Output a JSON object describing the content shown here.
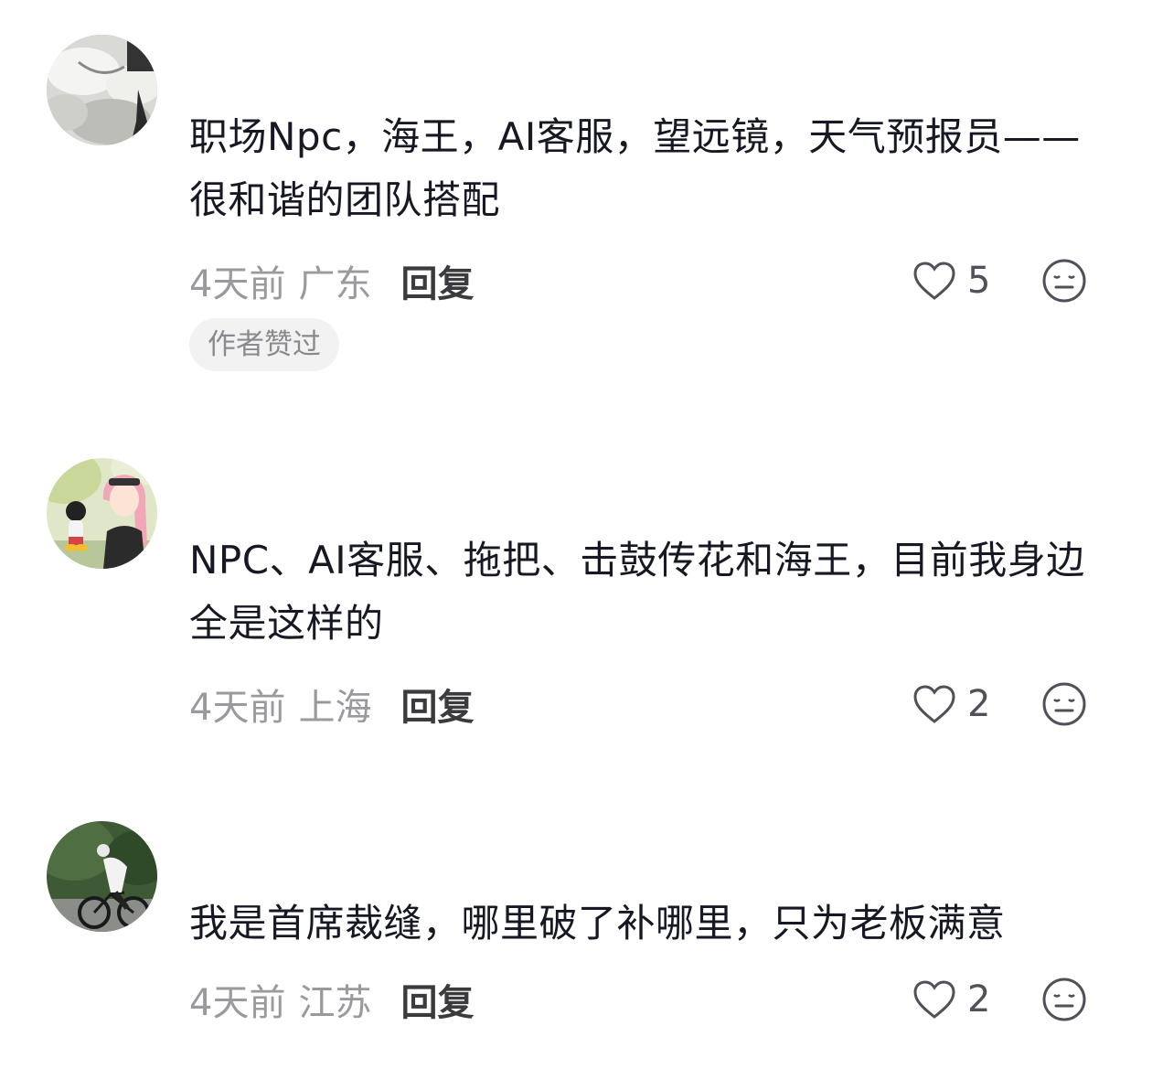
{
  "comments": [
    {
      "text": "职场Npc，海王，AI客服，望远镜，天气预报员——很和谐的团队搭配",
      "time": "4天前",
      "region": "广东",
      "reply_label": "回复",
      "like_count": "5",
      "badge": "作者赞过",
      "avatar_icon": "avatar-photo-white-flowers"
    },
    {
      "text": "NPC、AI客服、拖把、击鼓传花和海王，目前我身边全是这样的",
      "time": "4天前",
      "region": "上海",
      "reply_label": "回复",
      "like_count": "2",
      "avatar_icon": "avatar-illustration-pink-hair-girl"
    },
    {
      "text": "我是首席裁缝，哪里破了补哪里，只为老板满意",
      "time": "4天前",
      "region": "江苏",
      "reply_label": "回复",
      "like_count": "2",
      "avatar_icon": "avatar-photo-cyclist"
    }
  ],
  "icons": {
    "like": "heart-outline-icon",
    "emoji": "neutral-face-icon"
  },
  "colors": {
    "text_primary": "#161823",
    "text_secondary": "#9a9a9e",
    "reply": "#3a3a3f",
    "badge_bg": "#f2f2f3",
    "badge_text": "#8a8a8e"
  }
}
